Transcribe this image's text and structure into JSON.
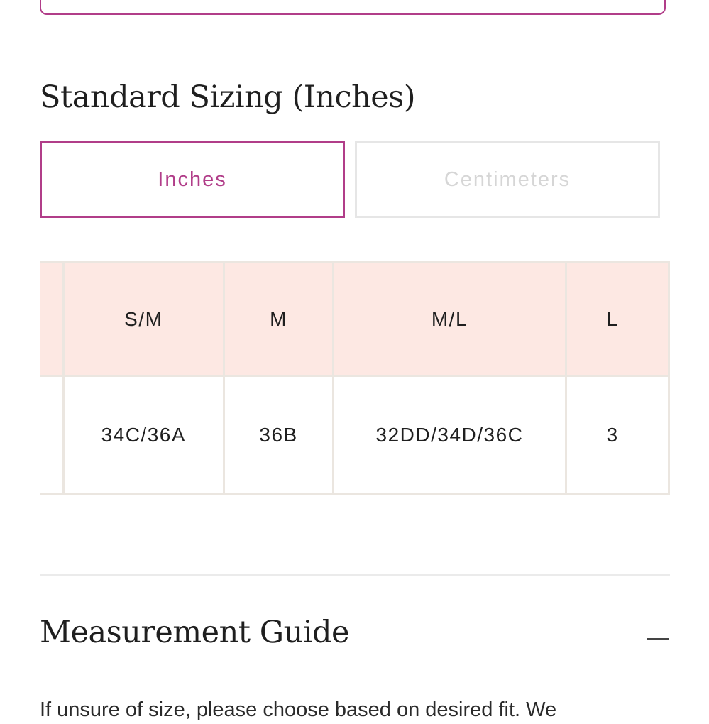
{
  "sizing": {
    "title": "Standard Sizing (Inches)",
    "units": {
      "inches_label": "Inches",
      "centimeters_label": "Centimeters"
    },
    "table": {
      "columns": [
        {
          "size": "",
          "bra": ""
        },
        {
          "size": "S/M",
          "bra": "34C/36A"
        },
        {
          "size": "M",
          "bra": "36B"
        },
        {
          "size": "M/L",
          "bra": "32DD/34D/36C"
        },
        {
          "size": "L",
          "bra": "3"
        }
      ]
    }
  },
  "measurement_guide": {
    "title": "Measurement Guide",
    "text": "If unsure of size, please choose based on desired fit. We"
  },
  "colors": {
    "accent": "#b13d89",
    "header_bg": "#fde8e3",
    "border": "#ebe6e0"
  }
}
